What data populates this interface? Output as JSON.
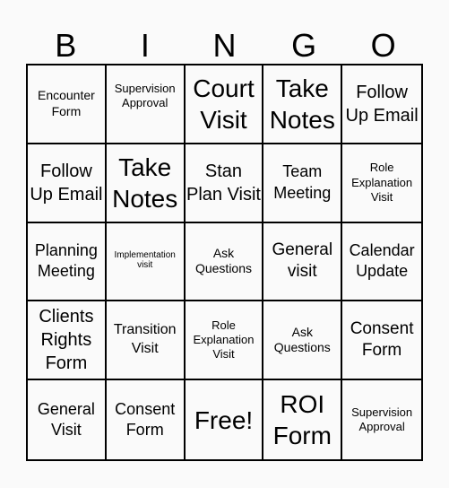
{
  "header": {
    "letters": [
      "B",
      "I",
      "N",
      "G",
      "O"
    ]
  },
  "cells": [
    "Encounter Form",
    "Supervision Approval",
    "Court Visit",
    "Take Notes",
    "Follow Up Email",
    "Follow Up Email",
    "Take Notes",
    "Stan Plan Visit",
    "Team Meeting",
    "Role Explanation Visit",
    "Planning Meeting",
    "Implementation visit",
    "Ask Questions",
    "General visit",
    "Calendar Update",
    "Clients Rights Form",
    "Transition Visit",
    "Role Explanation Visit",
    "Ask Questions",
    "Consent Form",
    "General Visit",
    "Consent Form",
    "Free!",
    "ROI Form",
    "Supervision Approval"
  ]
}
